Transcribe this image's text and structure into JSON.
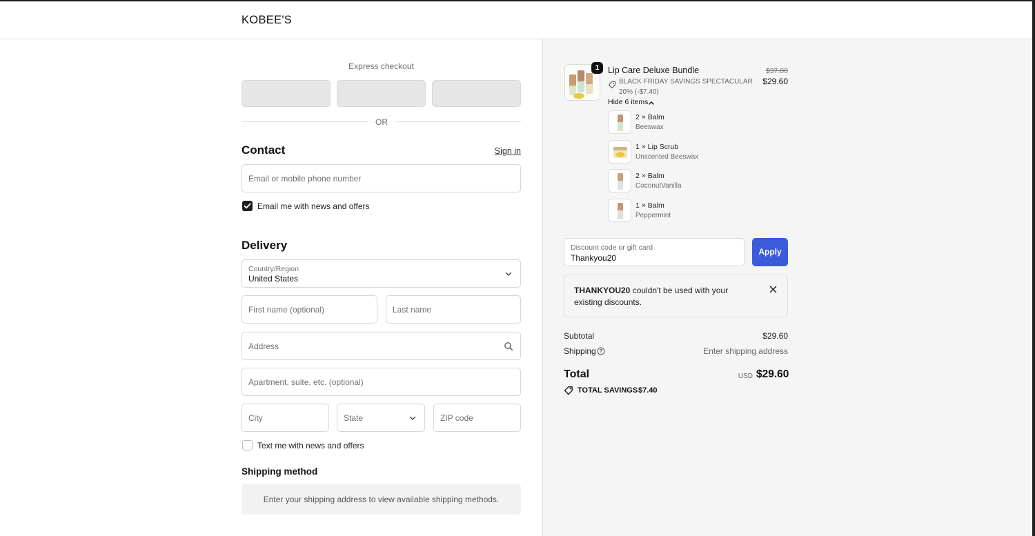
{
  "header": {
    "brand": "KOBEE'S"
  },
  "express": {
    "title": "Express checkout",
    "or": "OR"
  },
  "contact": {
    "title": "Contact",
    "signin": "Sign in",
    "email_placeholder": "Email or mobile phone number",
    "news_label": "Email me with news and offers",
    "news_checked": true
  },
  "delivery": {
    "title": "Delivery",
    "country_label": "Country/Region",
    "country_value": "United States",
    "first_name": "First name (optional)",
    "last_name": "Last name",
    "address": "Address",
    "apartment": "Apartment, suite, etc. (optional)",
    "city": "City",
    "state": "State",
    "zip": "ZIP code",
    "text_label": "Text me with news and offers",
    "text_checked": false
  },
  "shipping_method": {
    "title": "Shipping method",
    "message": "Enter your shipping address to view available shipping methods."
  },
  "order": {
    "product": {
      "name": "Lip Care Deluxe Bundle",
      "quantity": "1",
      "original_price": "$37.00",
      "price": "$29.60",
      "discount": "BLACK FRIDAY SAVINGS SPECTACULAR 20% (-$7.40)",
      "hide_items": "Hide 6 items"
    },
    "items": [
      {
        "name": "2 × Balm",
        "variant": "Beeswax"
      },
      {
        "name": "1 × Lip Scrub",
        "variant": "Unscented Beeswax"
      },
      {
        "name": "2 × Balm",
        "variant": "CoconutVanilla"
      },
      {
        "name": "1 × Balm",
        "variant": "Peppermint"
      }
    ],
    "discount_field": {
      "label": "Discount code or gift card",
      "value": "Thankyou20"
    },
    "apply": "Apply",
    "error": {
      "code": "THANKYOU20",
      "message": " couldn't be used with your existing discounts."
    },
    "subtotal_label": "Subtotal",
    "subtotal": "$29.60",
    "shipping_label": "Shipping",
    "shipping": "Enter shipping address",
    "total_label": "Total",
    "currency": "USD",
    "total": "$29.60",
    "savings_label": "TOTAL SAVINGS",
    "savings": "$7.40"
  },
  "colors": {
    "accent": "#3b5bdb",
    "sidebar_bg": "#f5f5f5",
    "express_btn": "#e6e6e6"
  },
  "icons": [
    "tag-icon",
    "chevron-up-icon",
    "chevron-down-icon",
    "search-icon",
    "close-icon",
    "help-icon",
    "checkmark-icon"
  ]
}
